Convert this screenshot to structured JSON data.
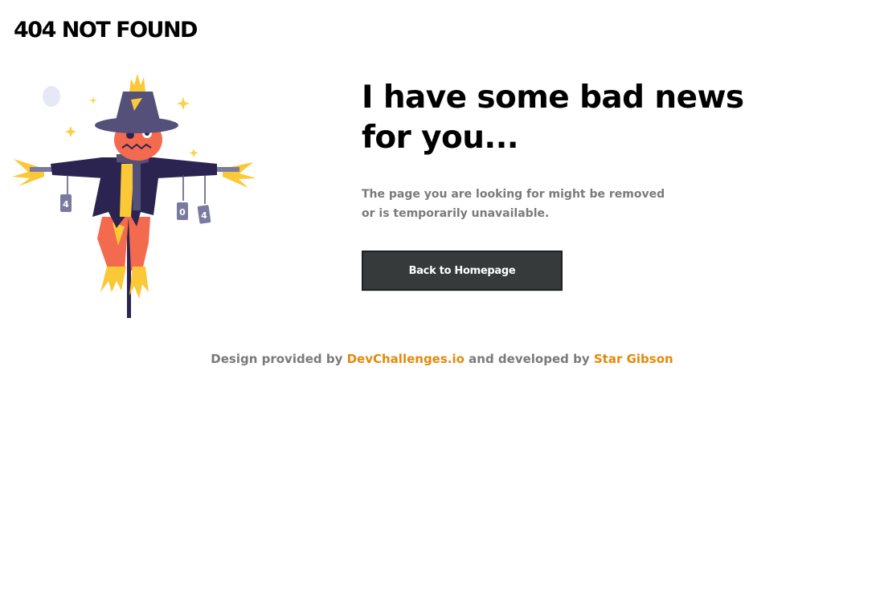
{
  "header": {
    "brand": "404 NOT FOUND"
  },
  "illustration": {
    "icon": "scarecrow-illustration",
    "tag_left": "4",
    "tag_middle": "0",
    "tag_right": "4"
  },
  "main": {
    "headline": "I have some bad news for you...",
    "message": "The page you are looking for might be removed or is temporarily unavailable.",
    "button_label": "Back to Homepage"
  },
  "footer": {
    "prefix": "Design provided by",
    "link1": "DevChallenges.io",
    "middle": "and developed by",
    "link2": "Star Gibson"
  },
  "colors": {
    "accent": "#e38a0b",
    "button_bg": "#363a3a",
    "muted_text": "#7a7a7a",
    "scarecrow_coat": "#2b2450",
    "scarecrow_face": "#f46a4e",
    "hat": "#55507a",
    "straw": "#fbc937"
  }
}
